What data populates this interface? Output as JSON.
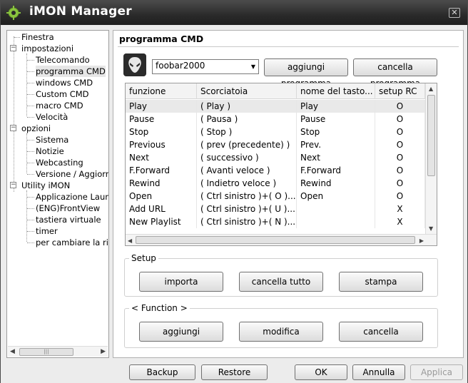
{
  "window": {
    "title": "iMON Manager",
    "close_label": "✕"
  },
  "tree": {
    "items": [
      {
        "label": "Finestra",
        "level": 0
      },
      {
        "label": "impostazioni",
        "level": 0,
        "expander": "−"
      },
      {
        "label": "Telecomando",
        "level": 1
      },
      {
        "label": "programma CMD",
        "level": 1,
        "selected": true
      },
      {
        "label": "windows CMD",
        "level": 1
      },
      {
        "label": "Custom CMD",
        "level": 1
      },
      {
        "label": "macro CMD",
        "level": 1
      },
      {
        "label": "Velocità",
        "level": 1
      },
      {
        "label": "opzioni",
        "level": 0,
        "expander": "−"
      },
      {
        "label": "Sistema",
        "level": 1
      },
      {
        "label": "Notizie",
        "level": 1
      },
      {
        "label": "Webcasting",
        "level": 1
      },
      {
        "label": "Versione / Aggiorn",
        "level": 1
      },
      {
        "label": "Utility iMON",
        "level": 0,
        "expander": "−"
      },
      {
        "label": "Applicazione Launc",
        "level": 1
      },
      {
        "label": "(ENG)FrontView",
        "level": 1
      },
      {
        "label": "tastiera virtuale",
        "level": 1
      },
      {
        "label": "timer",
        "level": 1
      },
      {
        "label": "per cambiare la riso",
        "level": 1
      }
    ]
  },
  "panel": {
    "title": "programma CMD",
    "program_select": {
      "value": "foobar2000"
    },
    "add_program_label": "aggiungi programma",
    "delete_program_label": "cancella programma",
    "columns": [
      "funzione",
      "Scorciatoia",
      "nome del tasto...",
      "setup RC"
    ],
    "rows": [
      [
        "Play",
        "( Play )",
        "Play",
        "O"
      ],
      [
        "Pause",
        "( Pausa )",
        "Pause",
        "O"
      ],
      [
        "Stop",
        "( Stop )",
        "Stop",
        "O"
      ],
      [
        "Previous",
        "( prev (precedente) )",
        "Prev.",
        "O"
      ],
      [
        "Next",
        "( successivo )",
        "Next",
        "O"
      ],
      [
        "F.Forward",
        "( Avanti veloce )",
        "F.Forward",
        "O"
      ],
      [
        "Rewind",
        "( Indietro veloce )",
        "Rewind",
        "O"
      ],
      [
        "Open",
        "( Ctrl sinistro )+( O )...",
        "Open",
        "O"
      ],
      [
        "Add URL",
        "( Ctrl sinistro )+( U )...",
        "",
        "X"
      ],
      [
        "New Playlist",
        "( Ctrl sinistro )+( N )...",
        "",
        "X"
      ]
    ],
    "setup_group": {
      "label": "Setup",
      "import_label": "importa",
      "clear_all_label": "cancella tutto",
      "print_label": "stampa"
    },
    "function_group": {
      "label": "< Function >",
      "add_label": "aggiungi",
      "edit_label": "modifica",
      "delete_label": "cancella"
    }
  },
  "footer": {
    "backup_label": "Backup",
    "restore_label": "Restore",
    "ok_label": "OK",
    "cancel_label": "Annulla",
    "apply_label": "Applica"
  }
}
